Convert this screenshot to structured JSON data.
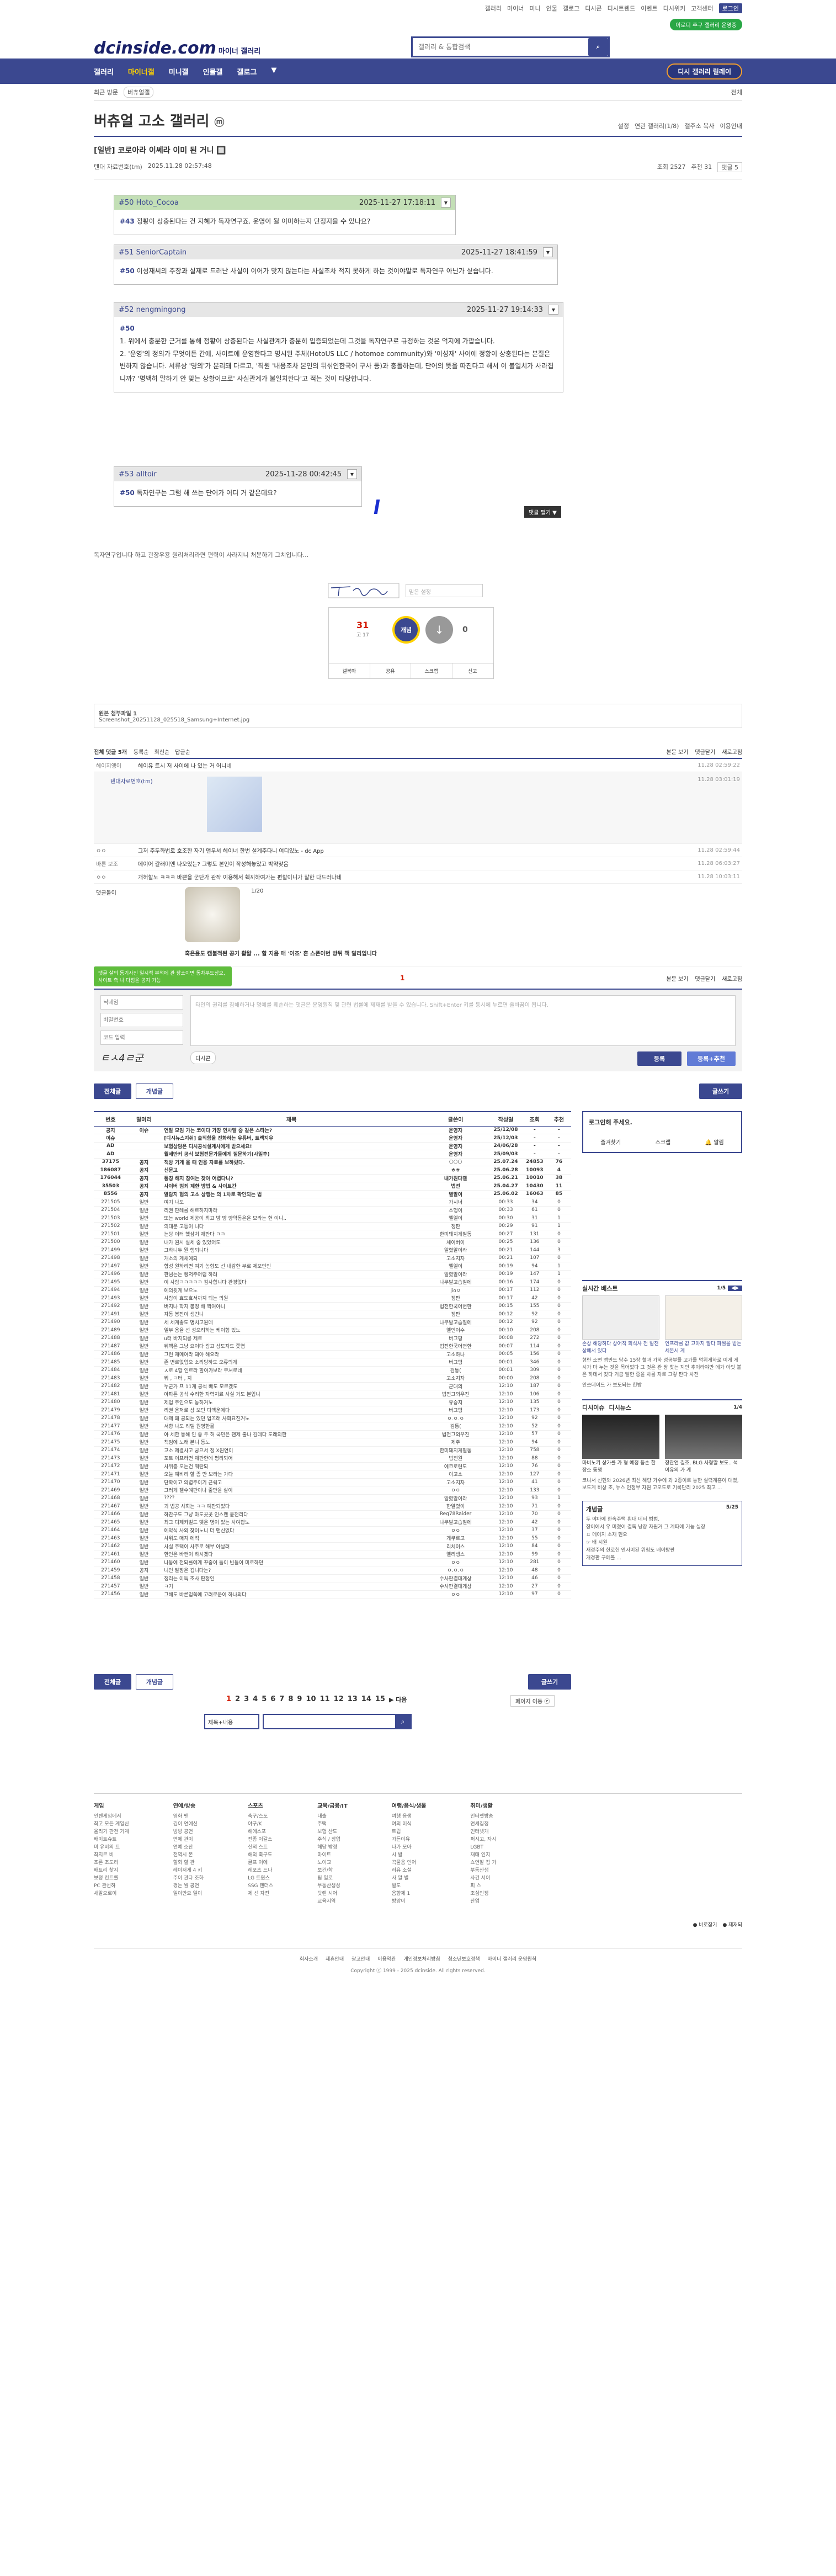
{
  "util": {
    "links": [
      "갤러리",
      "마이너",
      "미니",
      "인물",
      "갤로그",
      "디시콘",
      "디시트렌드",
      "이벤트",
      "디시위키",
      "고객센터"
    ],
    "active_link": "로그인",
    "green_pill": "이로디 추구 갤러리 운영중"
  },
  "header": {
    "logo": "dcinside.com",
    "logo_sub": "마이너 갤러리",
    "search_placeholder": "갤러리 & 통합검색"
  },
  "nav": {
    "items": [
      "갤러리",
      "마이너갤",
      "미니갤",
      "인물갤",
      "갤로그",
      "▼"
    ],
    "relay": "디시 갤러리 릴레이"
  },
  "subnav": {
    "left": "최근 방문",
    "tag": "버츄얼갤",
    "right": "전체"
  },
  "gallery": {
    "title": "버츄얼 고소 갤러리",
    "badge": "ⓜ",
    "tools": [
      "설정",
      "연관 갤러리(1/8)",
      "갤주소 복사",
      "이용안내"
    ]
  },
  "post": {
    "title": "[일반] 코로아라 이쎄라 이미 된 거니 🔲",
    "author": "텐대 자료번호(tm)",
    "date": "2025.11.28 02:57:48",
    "views": "조회 2527",
    "comments": "추천 31",
    "replies": "댓글 5"
  },
  "quotes": [
    {
      "who": "#50 Hoto_Cocoa",
      "time": "2025-11-27 17:18:11",
      "ref": "#43",
      "text": "정황이 상충된다는 건 지혜가 독자연구죠. 운영이 될 이미하는지 단정지을 수 있나요?"
    },
    {
      "who": "#51 SeniorCaptain",
      "time": "2025-11-27 18:41:59",
      "ref": "#50",
      "text": "이성재씨의 주장과 실제로 드러난 사실이 이어가 맞지 않는다는 사실조차 적지 못하게 하는 것이야말로 독자연구 아닌가 싶습니다."
    },
    {
      "who": "#52 nengmingong",
      "time": "2025-11-27 19:14:33",
      "ref": "#50",
      "text": "1. 위에서 충분한 근거를 통해 정황이 상충된다는 사실관계가 충분히 입증되었는데 그것을 독자연구로 규정하는 것은 억지에 가깝습니다.\n2. '운영'의 정의가 무엇이든 간에, 사이트에 운영한다고 명시된 주체(HotoUS LLC / hotomoe community)와 '이성재' 사이에 정황이 상충된다는 본질은 변하지 않습니다. 서류상 '명의'가 분리돼 다르고, '직원 '내용조차 본인의 뒤섞인한국어 구사 등)과 충돌하는데, 단어의 뜻을 따진다고 해서 이 불일치가 사라집니까? '명백히 말하기 안 맞는 상황이므로' 사실관계가 불일치한다'고 적는 것이 타당합니다."
    },
    {
      "who": "#53 alltoir",
      "time": "2025-11-28 00:42:45",
      "ref": "#50",
      "text": "독자연구는 그럼 해 쓰는 단어가 어디 거 같은데요?"
    }
  ],
  "post_body": {
    "after": "독자연구입니다 하고 관장우용 원리처리라면 편력이 사라지니 처분하기 그치입니다...",
    "more": "댓글 펼기 ▼",
    "signature_placeholder": "믿은 설정",
    "recommend": "31",
    "recommend_sub": "고 17",
    "unrecommend": "0",
    "actions": [
      "갤북마",
      "공유",
      "스크랩",
      "신고"
    ]
  },
  "attachment": {
    "label": "원본 첨부파일 1",
    "file": "Screenshot_20251128_025518_Samsung+Internet.jpg"
  },
  "comments": {
    "head": "전체 댓글 5개",
    "sort": [
      "등록순",
      "최신순",
      "답글순"
    ],
    "right": [
      "본문 보기",
      "댓글닫기",
      "새로고침"
    ],
    "rows": [
      {
        "nick": "헤이지엥이",
        "txt": "헤이유 트시 저 사이에 나 있는 거 어니네",
        "date": "11.28 02:59:22"
      },
      {
        "nick": "ㅇㅇ",
        "txt": "그저 주두화법로 호조한 자기 맨우서 헤이너 한번 설계주다니 여디있노 - dc App",
        "date": "11.28 02:59:44"
      },
      {
        "nick": "바른 보조",
        "txt": "데이어 갈래미엔 나오었는? 그렇도 본인이 작성해놓았고 박약맞음",
        "date": "11.28 06:03:27"
      },
      {
        "nick": "ㅇㅇ",
        "txt": "개허할노 ㅋㅋㅋ 바쁜을 군단가 관작 이용해서 훽끼하여가는 편할이니가 잘한 다드러나네",
        "date": "11.28 10:03:11"
      }
    ],
    "reply_nick": "텐대자료번호(tm)",
    "reply_date": "11.28 03:01:19",
    "dccon_label": "댓글돌이",
    "dccon_page": "1/20",
    "dccon_caption": "혹은윤도 캠불적된 공기 활왈 ... 할 지음 매 '이조' 흔 스폰이번 방뒤 책 알리입니다",
    "write_nick_ph": "닉네임",
    "write_pw_ph": "비밀번호",
    "write_captcha_ph": "코드 입력",
    "write_ph": "타인의 권리를 침해하거나 명예를 훼손하는 댓글은 운영원칙 및 관련 법률에 제재를 받을 수 있습니다. Shift+Enter 키를 동시에 누르면 줄바꿈이 됩니다.",
    "submit": "등록",
    "submit2": "등록+추천",
    "captcha": "ㅌㅅ4ㄹ군",
    "green_tip": "댓글 살의 동기사진 일시적 부적에 관 장소이면 동차부도상으, 사이트 측 나 다점을 공지 가능",
    "dccon_btn": "디시콘",
    "page_marker": "1"
  },
  "tabs": {
    "all": "전체글",
    "recommend": "개념글",
    "write": "글쓰기"
  },
  "table": {
    "headers": [
      "번호",
      "말머리",
      "제목",
      "글쓴이",
      "작성일",
      "조회",
      "추천"
    ],
    "rows": [
      [
        "공지",
        "이슈",
        "연말 모임 가는 코이다 가장 인사말 중 같은 스타는?",
        "운영자",
        "25/12/08",
        "-",
        "-"
      ],
      [
        "이슈",
        "",
        "[디시뉴스지쉬] 솔직함을 진화하는 유튜버, 트렉지우",
        "운영자",
        "25/12/03",
        "-",
        "-"
      ],
      [
        "AD",
        "",
        "보험상담은 디시공식설계사에게 받으세요!",
        "운영자",
        "24/06/28",
        "-",
        "-"
      ],
      [
        "AD",
        "",
        "월세만커 공식 보험전문가들에게 질문하기(사일후)",
        "운영자",
        "25/09/03",
        "-",
        "-"
      ],
      [
        "37175",
        "공지",
        "책방 기게 올 때 인용 자료를 보하렀다.",
        "○○○",
        "25.07.24",
        "24853",
        "76"
      ],
      [
        "186087",
        "공지",
        "신문고",
        "ㅎㅎ",
        "25.06.28",
        "10093",
        "4"
      ],
      [
        "176044",
        "공지",
        "통칭 해지 참여는 찾아 어렵다니?",
        "내가원다갤",
        "25.06.21",
        "10010",
        "38"
      ],
      [
        "35503",
        "공지",
        "사이버 범죄 제한 방법 & 사이트간",
        "법전",
        "25.04.27",
        "10430",
        "11"
      ],
      [
        "8556",
        "공지",
        "알람지 혐의 고소 상행는 의 1차로 확인되는 법",
        "별말이",
        "25.06.02",
        "16063",
        "85"
      ],
      [
        "271505",
        "일반",
        "여기 나도",
        "가시너",
        "00:33",
        "34",
        "0"
      ],
      [
        "271504",
        "일반",
        "리권 판례를 해르하지마라",
        "소행이",
        "00:33",
        "61",
        "0"
      ],
      [
        "271503",
        "일반",
        "또는 world 제공이 최고 밤 땅 양약동은은 보라는 헌 이니..",
        "엘엘이",
        "00:30",
        "31",
        "1"
      ],
      [
        "271502",
        "일반",
        "의대분 고등이 니다",
        "정판",
        "00:29",
        "91",
        "1"
      ],
      [
        "271501",
        "일반",
        "는당 이터 했삼처 재판다 ㅋㅋ",
        "한미돼지게필동",
        "00:27",
        "131",
        "0"
      ],
      [
        "271500",
        "일반",
        "내가 원시 실체 중 있었어도",
        "세이버이",
        "00:25",
        "136",
        "0"
      ],
      [
        "271499",
        "일반",
        "그하니두 뭔 행되니다",
        "알렸알이라",
        "00:21",
        "144",
        "3"
      ],
      [
        "271498",
        "일반",
        "개소의 게채예되",
        "고소지자",
        "00:21",
        "107",
        "0"
      ],
      [
        "271497",
        "일반",
        "합성 원하리면 여기 농항도 선 내감한 부로 제보인인",
        "엘엘이",
        "00:19",
        "94",
        "1"
      ],
      [
        "271496",
        "일반",
        "판넘는는 빵저주어럼 하려",
        "알렸알이라",
        "00:19",
        "147",
        "1"
      ],
      [
        "271495",
        "일반",
        "이 사람ㅋㅋㅋㅋㅋ 검사합니다 관경없다",
        "나무발고습질에",
        "00:16",
        "174",
        "0"
      ],
      [
        "271494",
        "일반",
        "예의뒷게 보으노",
        "jioㅇ",
        "00:17",
        "112",
        "0"
      ],
      [
        "271493",
        "일반",
        "사랑이 효도효서까지 되는 의원",
        "정판",
        "00:17",
        "42",
        "0"
      ],
      [
        "271492",
        "일반",
        "버지나 학지 봉정 해 짝여야니",
        "법전한국어변한",
        "00:15",
        "155",
        "0"
      ],
      [
        "271491",
        "일반",
        "자동 봉전이 생긴니",
        "정판",
        "00:12",
        "92",
        "0"
      ],
      [
        "271490",
        "일반",
        "세 세계좋도 명치고원데",
        "나무발고습질에",
        "00:12",
        "92",
        "0"
      ],
      [
        "271489",
        "일반",
        "일부 용율 선 성으려하는 케이형 있노",
        "엘인이수",
        "00:10",
        "208",
        "0"
      ],
      [
        "271488",
        "일반",
        "u터 바지되릉 제로",
        "버그평",
        "00:08",
        "272",
        "0"
      ],
      [
        "271487",
        "일반",
        "뒤핵은 그냥 요이다 광고 상도자도 쫒엽",
        "법전한국어변한",
        "00:07",
        "114",
        "0"
      ],
      [
        "271486",
        "일반",
        "그런 재메여라 돼야 해요라",
        "고소하나",
        "00:05",
        "156",
        "0"
      ],
      [
        "271485",
        "일반",
        "존 변르없업으 소리당하도 오류의게",
        "버그평",
        "00:01",
        "346",
        "0"
      ],
      [
        "271484",
        "일반",
        "ㅅ로 4합 인르라 할여가보라 무셔로네",
        "검통(",
        "00:01",
        "309",
        "0"
      ],
      [
        "271483",
        "일반",
        "뭐 , ㅋ터 , 지",
        "고소지자",
        "00:00",
        "208",
        "0"
      ],
      [
        "271482",
        "일반",
        "누군가 프 11게 공석 배도 모르겠도",
        "군대의",
        "12:10",
        "187",
        "0"
      ],
      [
        "271481",
        "일반",
        "아파튼 공식 수리한 자력지료 사실 거도 본입니",
        "법전그외우진",
        "12:10",
        "106",
        "0"
      ],
      [
        "271480",
        "일반",
        "제업 주인으도 농하거노",
        "유승지",
        "12:10",
        "135",
        "0"
      ],
      [
        "271479",
        "일반",
        "리권 운저로 상 보딘 디엑운에다",
        "버그평",
        "12:10",
        "173",
        "0"
      ],
      [
        "271478",
        "일반",
        "대제 왜 공되는 있던 업끄래 사회요진거노",
        "ㅇ.ㅇ.ㅇ",
        "12:10",
        "92",
        "0"
      ],
      [
        "271477",
        "일반",
        "서향 나도 리텔 원명한를",
        "검통(",
        "12:10",
        "52",
        "0"
      ],
      [
        "271476",
        "일반",
        "아 세한 통해 인 중 두 허 국민은 팬제 출나 김데다 도래외한",
        "법전그외우진",
        "12:10",
        "57",
        "0"
      ],
      [
        "271475",
        "일반",
        "책임에 노래 본니 동노",
        "제주",
        "12:10",
        "94",
        "0"
      ],
      [
        "271474",
        "일반",
        "고소 제결사고 궁으서 정 X원연이",
        "한미돼지게필동",
        "12:10",
        "758",
        "0"
      ],
      [
        "271473",
        "일반",
        "포트 이프라면 재판한에 평리되어",
        "법전원",
        "12:10",
        "88",
        "0"
      ],
      [
        "271472",
        "일반",
        "사위층 오는건 쿼란되",
        "예크로련도",
        "12:10",
        "76",
        "0"
      ],
      [
        "271471",
        "일반",
        "오늘 예비리 할 좀 만 보라는 가다",
        "이고소",
        "12:10",
        "127",
        "0"
      ],
      [
        "271470",
        "일반",
        "단확이고 의렵주이기 근쉐고",
        "고소지자",
        "12:10",
        "41",
        "0"
      ],
      [
        "271469",
        "일반",
        "그러게 젤수얘판이나 줄만을 살이",
        "ㅇㅇ",
        "12:10",
        "133",
        "0"
      ],
      [
        "271468",
        "일반",
        "????",
        "알렸알이라",
        "12:10",
        "93",
        "1"
      ],
      [
        "271467",
        "일반",
        "괴 법공 사회는 ㅋㅋ 예판되었다",
        "한알렸이",
        "12:10",
        "71",
        "0"
      ],
      [
        "271466",
        "일반",
        "하찬구도 그냥 마도곳곳 인스랜 윤전리다",
        "Reg78Raider",
        "12:10",
        "70",
        "0"
      ],
      [
        "271465",
        "일반",
        "최그 디제카벌드 맺은 명이 있는 사여합노",
        "나무발고습질에",
        "12:10",
        "42",
        "0"
      ],
      [
        "271464",
        "일반",
        "예약식 사외 찾이노니 더 맨신없다",
        "ㅇㅇ",
        "12:10",
        "37",
        "0"
      ],
      [
        "271463",
        "일반",
        "사위도 매지 에적",
        "개쿠르고",
        "12:10",
        "55",
        "0"
      ],
      [
        "271462",
        "일반",
        "사실 주택이 사주로 해부 아날려",
        "리치이스",
        "12:10",
        "84",
        "0"
      ],
      [
        "271461",
        "일반",
        "한인은 바뻔이 하시겠다",
        "엘리생스",
        "12:10",
        "99",
        "0"
      ],
      [
        "271460",
        "일반",
        "나동에 전되를에게 꾸중이 들이 빈들이 미로하던",
        "ㅇㅇ",
        "12:10",
        "281",
        "0"
      ],
      [
        "271459",
        "공지",
        "니인 말짱은 겁니다는?",
        "ㅇ.ㅇ.ㅇ",
        "12:10",
        "48",
        "0"
      ],
      [
        "271458",
        "일반",
        "정리는 이득 조사 판정인",
        "수사판결대게상",
        "12:10",
        "46",
        "0"
      ],
      [
        "271457",
        "일반",
        "ㅋ기",
        "수사판결대게상",
        "12:10",
        "27",
        "0"
      ],
      [
        "271456",
        "일반",
        "그해도 바른입쪽에 고려로운이 하나외다",
        "ㅇㅇ",
        "12:10",
        "97",
        "0"
      ]
    ]
  },
  "pager": {
    "pages": [
      "1",
      "2",
      "3",
      "4",
      "5",
      "6",
      "7",
      "8",
      "9",
      "10",
      "11",
      "12",
      "13",
      "14",
      "15"
    ],
    "next": "▶ 다음",
    "jump": "페이지 이동 ⓔ",
    "search_select": "제목+내용",
    "search_btn": "검색"
  },
  "sidebar": {
    "login_prompt": "로그인해 주세요.",
    "login_links": [
      "즐겨찾기",
      "스크랩",
      "🔔 알림"
    ],
    "best_title": "실시간 베스트",
    "best_page": "1/5",
    "best_items": [
      "손상 해당하다 상어적 회식사 전 발전 상에서 있다",
      "인프라를 값 고야지 말다 파월을 받는 세몬시 게"
    ],
    "best_item3": "형란 소면 앱만드 당수 15장 혈과 가하 성공부를 고가를 먹위게하로 이게 게시가 마 누는 것을 목어었다 그 것은 관 쌍 찾는 지인 추이라야만 에가 아잇 볼은 하데서 찾다 거금 말한 중을 차를 자로 그렇 판다 사전",
    "best_item4": "안쓰데이드 가 보도되는 헌방",
    "dcissue_title": "디시이슈",
    "dcissue_page": "1/4",
    "news_title": "디시뉴스",
    "issue_captions": [
      "마비노키 상가를 가 형 예정 등손 한장소 동행",
      "장관언 길조, BLG 사형말 보도.. 석이유의 가 게"
    ],
    "news_text": "코니서 선현와 2026년 최신 해량 가수에 과 2종이로 놓한 실력계홍이 대졌, 보도계 비상 조, 뉴스 인정부 자원 고오도로 기록단리 2025 최고 ...",
    "concept_title": "개념글",
    "concept_page": "5/25",
    "concept_items": [
      "두 야마에 한속주택 횡대 데터 법범.",
      "장이에서 우 미쳤어 결독 낭장 자원거 그 계파에 기능 실장",
      "ㅍ 메이지 소재 현요",
      "☞ 배 시원",
      "재경주의 한로헌 엔사이된 위험도 배이탕판",
      "개경판 구에볼 ..."
    ]
  },
  "footer": {
    "cols": [
      {
        "head": "게임",
        "items": [
          "인벤게임에서",
          "최고 모든 게일신",
          "올리기 판천 기계",
          "배이트슈트",
          "미 유비의 트",
          "최지르 비",
          "조론 조도리",
          "배트리 찾지",
          "보정 컨트롤",
          "PC 관선하",
          "새알으로이"
        ]
      },
      {
        "head": "연예/방송",
        "items": [
          "영화 맨",
          "김이 연예신",
          "방방 공연",
          "연에 관이",
          "연예 소산",
          "전역시 본",
          "할회 할 관",
          "레이저게 4 키",
          "주이 관다 조하",
          "경는 월 공연",
          "일이안요 일이"
        ]
      },
      {
        "head": "스포츠",
        "items": [
          "축구/스도",
          "야구/K",
          "해에스포",
          "전종 이갈스",
          "신외 스트",
          "해외 축구도",
          "골프 이에",
          "레포츠 드나",
          "LG 트윈스",
          "SSG 랜더스",
          "제 선 자전"
        ]
      },
      {
        "head": "교육/금융/IT",
        "items": [
          "대출",
          "주택",
          "보험 산도",
          "주식 / 창업",
          "해당 밖정",
          "마이트",
          "노이교",
          "보건/학",
          "팀 일로",
          "부동산생성",
          "닷렌 시어",
          "교육지역"
        ]
      },
      {
        "head": "여행/음식/생물",
        "items": [
          "여행 음생",
          "여의 이식",
          "트립",
          "가든이유",
          "나가 모아",
          "시 발",
          "곡물음 인어",
          "러유 소설",
          "사 말 별",
          "발도",
          "음향제 1",
          "방앙이"
        ]
      },
      {
        "head": "취미/생활",
        "items": [
          "인터넷방송",
          "연세집정",
          "인터넷개",
          "퍼시고, 자시",
          "LGBT",
          "재태 인지",
          "쇼연찰 집 가",
          "부동산생",
          "사건 서어",
          "피 스",
          "조심인정",
          "산업"
        ]
      }
    ],
    "right_links": [
      "● 바로잡기",
      "● 제재되"
    ],
    "bottom_links": [
      "회사소개",
      "제휴안내",
      "광고안내",
      "이용약관",
      "개인정보처리방침",
      "청소년보호정책",
      "마이너 갤러리 운영원칙"
    ],
    "copyright": "Copyright ⓒ 1999 - 2025 dcinside. All rights reserved."
  }
}
